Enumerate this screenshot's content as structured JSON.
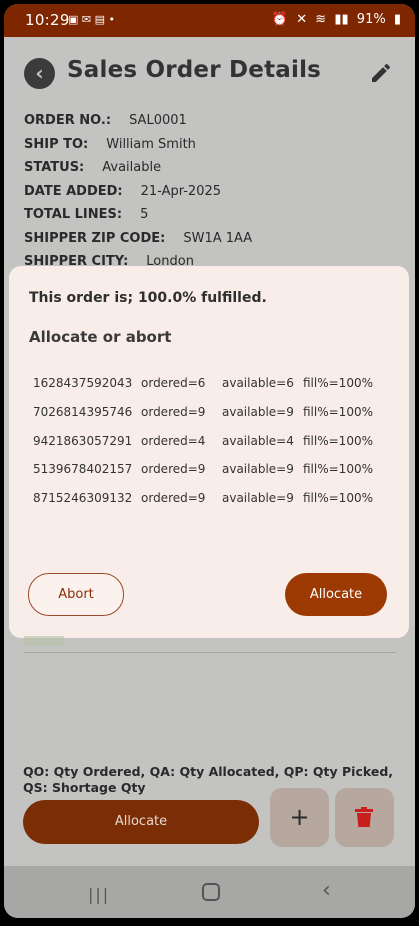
{
  "status_bar": {
    "time": "10:29",
    "battery": "91%"
  },
  "header": {
    "title": "Sales Order Details"
  },
  "order": [
    {
      "key": "ORDER NO.:",
      "value": "SAL0001"
    },
    {
      "key": "SHIP TO:",
      "value": "William  Smith"
    },
    {
      "key": "STATUS:",
      "value": "Available"
    },
    {
      "key": "DATE ADDED:",
      "value": "21-Apr-2025"
    },
    {
      "key": "TOTAL LINES:",
      "value": "5"
    },
    {
      "key": "SHIPPER ZIP CODE:",
      "value": "SW1A 1AA"
    },
    {
      "key": "SHIPPER CITY:",
      "value": "London"
    }
  ],
  "dialog": {
    "fulfilled_text": "This order is; 100.0% fulfilled.",
    "subtitle": "Allocate or abort",
    "lines": [
      {
        "code": "1628437592043",
        "ordered": "ordered=6",
        "available": "available=6",
        "fill": "fill%=100%"
      },
      {
        "code": "7026814395746",
        "ordered": "ordered=9",
        "available": "available=9",
        "fill": "fill%=100%"
      },
      {
        "code": "9421863057291",
        "ordered": "ordered=4",
        "available": "available=4",
        "fill": "fill%=100%"
      },
      {
        "code": "5139678402157",
        "ordered": "ordered=9",
        "available": "available=9",
        "fill": "fill%=100%"
      },
      {
        "code": "8715246309132",
        "ordered": "ordered=9",
        "available": "available=9",
        "fill": "fill%=100%"
      }
    ],
    "abort_label": "Abort",
    "allocate_label": "Allocate"
  },
  "footer": {
    "legend": "QO: Qty Ordered, QA: Qty Allocated, QP: Qty Picked, QS: Shortage Qty",
    "allocate_label": "Allocate",
    "add_label": "+"
  },
  "colors": {
    "accent": "#9d3a03",
    "status_bar": "#7e2600",
    "dialog_bg": "#f8ede8",
    "delete": "#c81e1e"
  }
}
